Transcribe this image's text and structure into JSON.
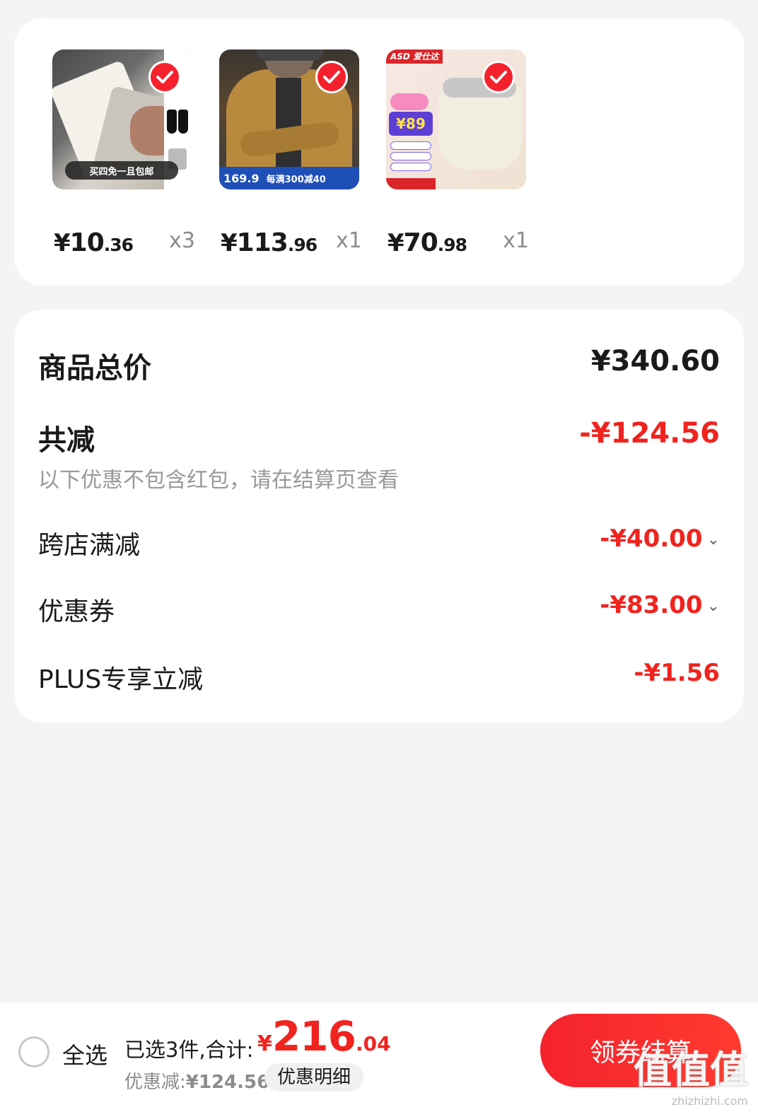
{
  "products": [
    {
      "name": "socks",
      "banner": "买四免一且包邮",
      "price_int": "10",
      "price_dec": ".36",
      "currency": "¥",
      "qty": "x3"
    },
    {
      "name": "jacket",
      "banner_price": "169.9",
      "banner_text": "每满300减40",
      "price_int": "113",
      "price_dec": ".96",
      "currency": "¥",
      "qty": "x1"
    },
    {
      "name": "electric-pot",
      "brand": "ASD 爱仕达",
      "promo_price": "¥89",
      "price_int": "70",
      "price_dec": ".98",
      "currency": "¥",
      "qty": "x1"
    }
  ],
  "summary": {
    "total_label": "商品总价",
    "total_value": "¥340.60",
    "reduce_label": "共减",
    "reduce_value": "-¥124.56",
    "hint": "以下优惠不包含红包，请在结算页查看",
    "items": [
      {
        "label": "跨店满减",
        "value": "-¥40.00",
        "expandable": true
      },
      {
        "label": "优惠券",
        "value": "-¥83.00",
        "expandable": true
      },
      {
        "label": "PLUS专享立减",
        "value": "-¥1.56",
        "expandable": false
      }
    ]
  },
  "bottom": {
    "select_all": "全选",
    "selected_info": "已选3件,合计:",
    "sum_currency": "¥",
    "sum_int": "216",
    "sum_dec": ".04",
    "discount_label": "优惠减:",
    "discount_amount": "¥124.56",
    "detail_button": "优惠明细",
    "checkout_button": "领券结算"
  },
  "watermark": {
    "big": "值值值",
    "small": "zhizhizhi.com"
  },
  "colors": {
    "accent": "#f0231e",
    "background": "#f4f4f4"
  }
}
